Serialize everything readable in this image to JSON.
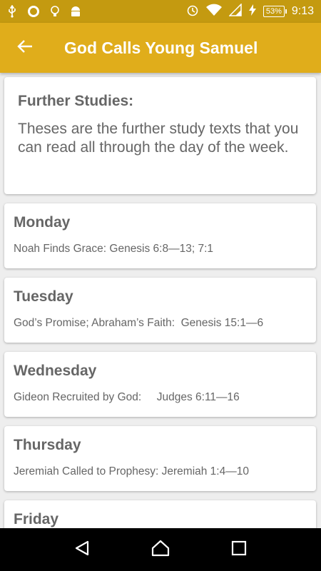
{
  "status_bar": {
    "battery": "53%",
    "time": "9:13"
  },
  "app_bar": {
    "title": "God Calls Young Samuel"
  },
  "intro": {
    "title": "Further Studies:",
    "text": "Theses are the further study texts that you can read all through the day of the week."
  },
  "days": [
    {
      "name": "Monday",
      "text": "Noah Finds Grace: Genesis 6:8—13; 7:1"
    },
    {
      "name": "Tuesday",
      "text": "God’s Promise; Abraham’s Faith:  Genesis 15:1—6"
    },
    {
      "name": "Wednesday",
      "text": "Gideon Recruited by God:     Judges 6:11—16"
    },
    {
      "name": "Thursday",
      "text": "Jeremiah Called to Prophesy: Jeremiah 1:4—10"
    },
    {
      "name": "Friday",
      "text": ""
    }
  ]
}
